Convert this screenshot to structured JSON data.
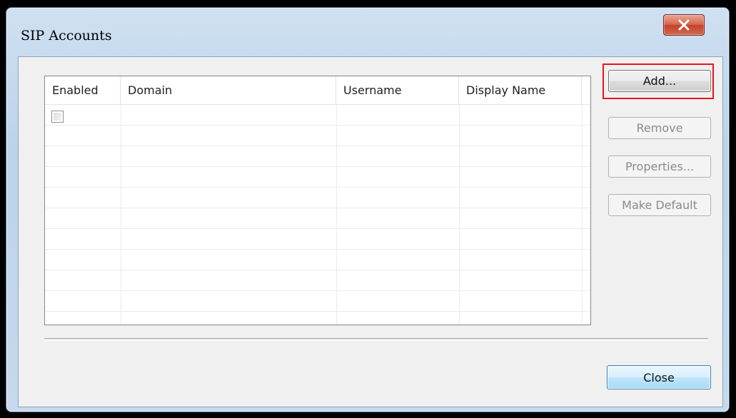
{
  "window": {
    "title": "SIP Accounts",
    "close_icon": "close-x-icon"
  },
  "accounts_list": {
    "columns": [
      "Enabled",
      "Domain",
      "Username",
      "Display Name"
    ],
    "rows": [
      {
        "enabled": false,
        "domain": "",
        "username": "",
        "display_name": ""
      }
    ]
  },
  "buttons": {
    "add": "Add...",
    "remove": "Remove",
    "properties": "Properties...",
    "make_default": "Make Default",
    "close": "Close"
  },
  "states": {
    "add_enabled": true,
    "remove_enabled": false,
    "properties_enabled": false,
    "make_default_enabled": false,
    "close_enabled": true
  },
  "colors": {
    "highlight": "#e8141c",
    "close_button_accent": "#3c7fb1"
  }
}
